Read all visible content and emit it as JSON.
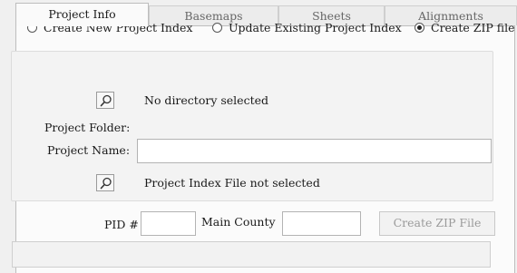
{
  "tabs": [
    {
      "label": "Project Info",
      "active": true
    },
    {
      "label": "Basemaps",
      "active": false
    },
    {
      "label": "Sheets",
      "active": false
    },
    {
      "label": "Alignments",
      "active": false
    }
  ],
  "mode_options": [
    {
      "label": "Create New Project Index",
      "selected": false
    },
    {
      "label": "Update Existing Project Index",
      "selected": false
    },
    {
      "label": "Create ZIP file",
      "selected": true
    }
  ],
  "project_folder": {
    "label": "Project Folder:",
    "status": "No directory selected",
    "browse_icon": "magnifier-icon"
  },
  "project_name": {
    "label": "Project Name:",
    "value": ""
  },
  "index_file": {
    "status": "Project Index File not selected",
    "browse_icon": "magnifier-icon"
  },
  "pid": {
    "label": "PID #",
    "value": ""
  },
  "main_county": {
    "label": "Main County",
    "value": ""
  },
  "create_zip_button": {
    "label": "Create ZIP File",
    "enabled": false
  },
  "status_bar": {
    "text": ""
  }
}
